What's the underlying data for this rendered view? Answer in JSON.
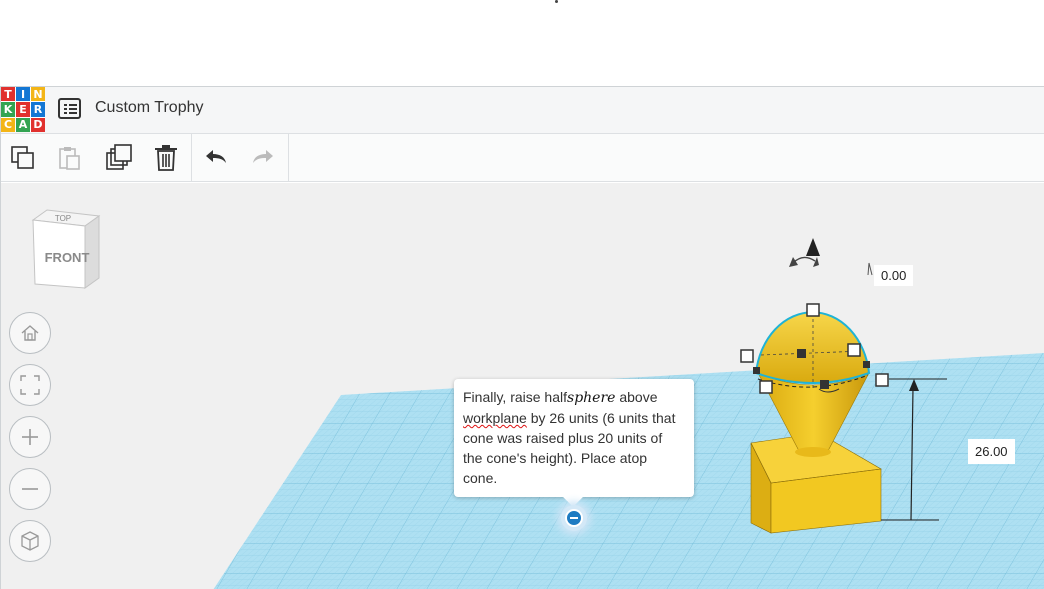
{
  "app": {
    "logo_letters": [
      "T",
      "I",
      "N",
      "K",
      "E",
      "R",
      "C",
      "A",
      "D"
    ],
    "logo_colors": [
      "#e1312e",
      "#1477d4",
      "#f3b517",
      "#33a452",
      "#e1312e",
      "#1477d4",
      "#f3b517",
      "#33a452",
      "#e1312e"
    ],
    "title": "Custom Trophy"
  },
  "toolbar": {
    "buttons": [
      {
        "name": "copy",
        "icon": "copy-icon",
        "enabled": true
      },
      {
        "name": "paste",
        "icon": "paste-icon",
        "enabled": false
      },
      {
        "name": "duplicate",
        "icon": "duplicate-icon",
        "enabled": true
      },
      {
        "name": "delete",
        "icon": "trash-icon",
        "enabled": true
      },
      {
        "name": "undo",
        "icon": "undo-icon",
        "enabled": true
      },
      {
        "name": "redo",
        "icon": "redo-icon",
        "enabled": false
      }
    ]
  },
  "viewcube": {
    "top_label": "TOP",
    "front_label": "FRONT"
  },
  "view_controls": [
    "home-icon",
    "fit-view-icon",
    "zoom-in-icon",
    "zoom-out-icon",
    "perspective-icon"
  ],
  "dimensions": {
    "rotation_value": "0.00",
    "height_value": "26.00"
  },
  "tooltip": {
    "part1": "Finally, raise half",
    "handwritten": "sphere",
    "part2": " above ",
    "misspelled": "workplane",
    "part3": " by 26 units (6 units that cone was raised plus 20 units of the cone's height). Place atop cone."
  },
  "colors": {
    "shape_yellow": "#f4c81e",
    "grid_blue": "#a9dcef",
    "accent_blue": "#1e7bc2"
  }
}
